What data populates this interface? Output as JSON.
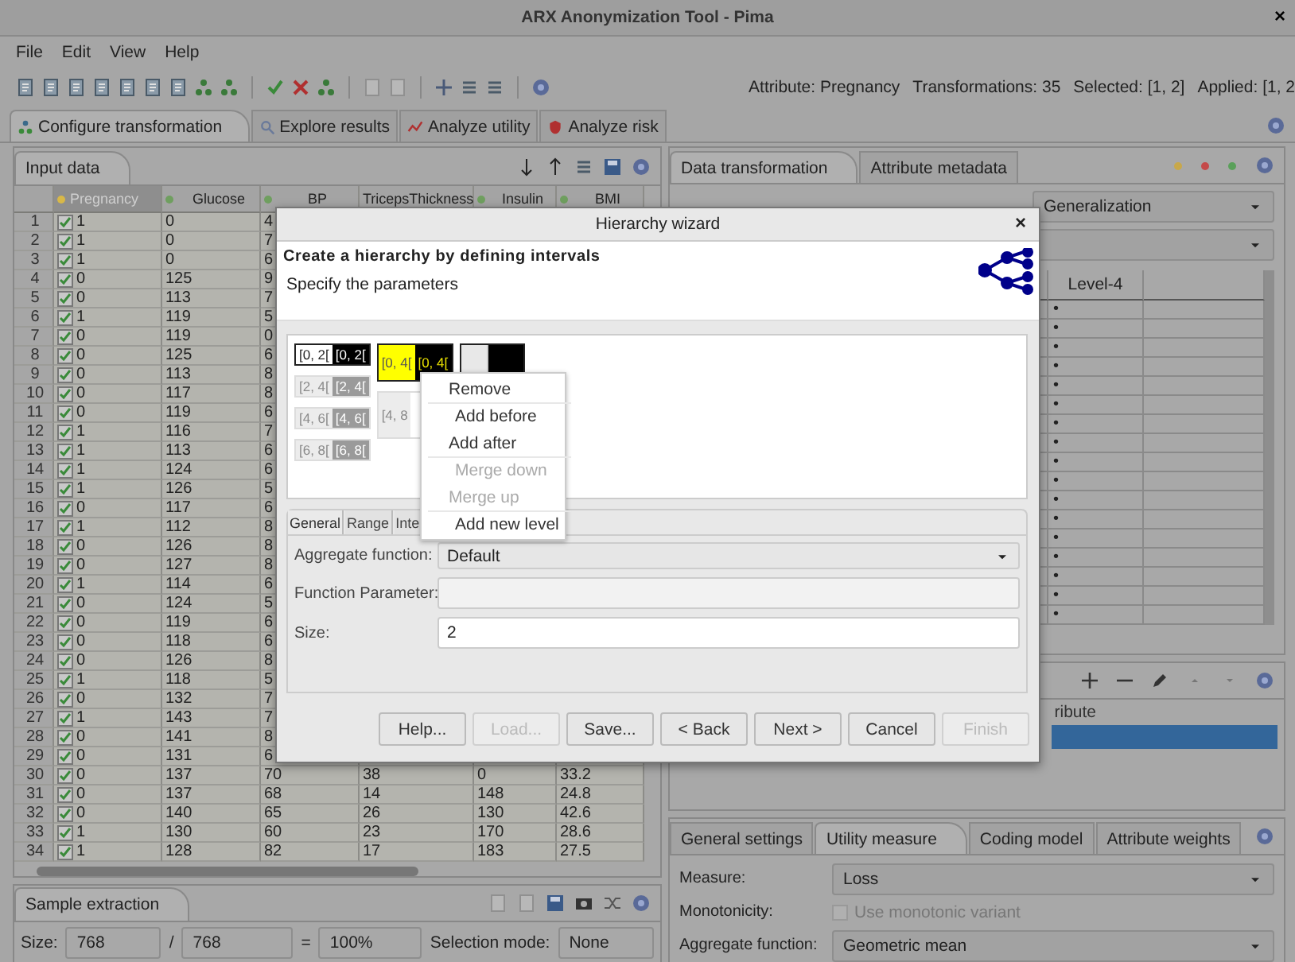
{
  "window": {
    "title": "ARX Anonymization Tool - Pima",
    "close": "×"
  },
  "menu": [
    "File",
    "Edit",
    "View",
    "Help"
  ],
  "status": [
    "Attribute: Pregnancy",
    "Transformations: 35",
    "Selected: [1, 2]",
    "Applied: [1, 2"
  ],
  "perspective_tabs": [
    {
      "label": "Configure transformation",
      "selected": true
    },
    {
      "label": "Explore results",
      "selected": false
    },
    {
      "label": "Analyze utility",
      "selected": false
    },
    {
      "label": "Analyze risk",
      "selected": false
    }
  ],
  "input_data": {
    "tab": "Input data",
    "columns": [
      {
        "label": "Pregnancy",
        "selected": true,
        "color": "#d8b848"
      },
      {
        "label": "Glucose",
        "selected": false,
        "color": "#6f9f5f"
      },
      {
        "label": "BP",
        "selected": false,
        "color": "#6f9f5f"
      },
      {
        "label": "TricepsThickness",
        "selected": false
      },
      {
        "label": "Insulin",
        "selected": false,
        "color": "#6f9f5f"
      },
      {
        "label": "BMI",
        "selected": false,
        "color": "#6f9f5f"
      }
    ],
    "rows": [
      {
        "n": "1",
        "included": true,
        "cells": [
          "1",
          "0",
          "4"
        ]
      },
      {
        "n": "2",
        "included": true,
        "cells": [
          "1",
          "0",
          "7"
        ]
      },
      {
        "n": "3",
        "included": true,
        "cells": [
          "1",
          "0",
          "6"
        ]
      },
      {
        "n": "4",
        "included": true,
        "cells": [
          "0",
          "125",
          "9"
        ]
      },
      {
        "n": "5",
        "included": true,
        "cells": [
          "0",
          "113",
          "7"
        ]
      },
      {
        "n": "6",
        "included": true,
        "cells": [
          "1",
          "119",
          "5"
        ]
      },
      {
        "n": "7",
        "included": true,
        "cells": [
          "0",
          "119",
          "0"
        ]
      },
      {
        "n": "8",
        "included": true,
        "cells": [
          "0",
          "125",
          "6"
        ]
      },
      {
        "n": "9",
        "included": true,
        "cells": [
          "0",
          "113",
          "8"
        ]
      },
      {
        "n": "10",
        "included": true,
        "cells": [
          "0",
          "117",
          "8"
        ]
      },
      {
        "n": "11",
        "included": true,
        "cells": [
          "0",
          "119",
          "6"
        ]
      },
      {
        "n": "12",
        "included": true,
        "cells": [
          "1",
          "116",
          "7"
        ]
      },
      {
        "n": "13",
        "included": true,
        "cells": [
          "1",
          "113",
          "6"
        ]
      },
      {
        "n": "14",
        "included": true,
        "cells": [
          "1",
          "124",
          "6"
        ]
      },
      {
        "n": "15",
        "included": true,
        "cells": [
          "1",
          "126",
          "5"
        ]
      },
      {
        "n": "16",
        "included": true,
        "cells": [
          "0",
          "117",
          "6"
        ]
      },
      {
        "n": "17",
        "included": true,
        "cells": [
          "1",
          "112",
          "8"
        ]
      },
      {
        "n": "18",
        "included": true,
        "cells": [
          "0",
          "126",
          "8"
        ]
      },
      {
        "n": "19",
        "included": true,
        "cells": [
          "0",
          "127",
          "8"
        ]
      },
      {
        "n": "20",
        "included": true,
        "cells": [
          "1",
          "114",
          "6"
        ]
      },
      {
        "n": "21",
        "included": true,
        "cells": [
          "0",
          "124",
          "5"
        ]
      },
      {
        "n": "22",
        "included": true,
        "cells": [
          "0",
          "119",
          "6"
        ]
      },
      {
        "n": "23",
        "included": true,
        "cells": [
          "0",
          "118",
          "6"
        ]
      },
      {
        "n": "24",
        "included": true,
        "cells": [
          "0",
          "126",
          "8"
        ]
      },
      {
        "n": "25",
        "included": true,
        "cells": [
          "1",
          "118",
          "5"
        ]
      },
      {
        "n": "26",
        "included": true,
        "cells": [
          "0",
          "132",
          "7"
        ]
      },
      {
        "n": "27",
        "included": true,
        "cells": [
          "1",
          "143",
          "7"
        ]
      },
      {
        "n": "28",
        "included": true,
        "cells": [
          "0",
          "141",
          "8"
        ]
      },
      {
        "n": "29",
        "included": true,
        "cells": [
          "0",
          "131",
          "6"
        ]
      },
      {
        "n": "30",
        "included": true,
        "cells": [
          "0",
          "137",
          "70",
          "38",
          "0",
          "33.2"
        ]
      },
      {
        "n": "31",
        "included": true,
        "cells": [
          "0",
          "137",
          "68",
          "14",
          "148",
          "24.8"
        ]
      },
      {
        "n": "32",
        "included": true,
        "cells": [
          "0",
          "140",
          "65",
          "26",
          "130",
          "42.6"
        ]
      },
      {
        "n": "33",
        "included": true,
        "cells": [
          "1",
          "130",
          "60",
          "23",
          "170",
          "28.6"
        ]
      },
      {
        "n": "34",
        "included": true,
        "cells": [
          "1",
          "128",
          "82",
          "17",
          "183",
          "27.5"
        ]
      }
    ]
  },
  "sample_extraction": {
    "tab": "Sample extraction",
    "size_label": "Size:",
    "size": "768",
    "slash": "/",
    "total": "768",
    "equals": "=",
    "percent": "100%",
    "mode_label": "Selection mode:",
    "mode": "None"
  },
  "data_transformation": {
    "tabs": [
      {
        "label": "Data transformation",
        "selected": true
      },
      {
        "label": "Attribute metadata",
        "selected": false
      }
    ],
    "indicators": [
      {
        "color": "#c8a84a"
      },
      {
        "color": "#c44a4a"
      },
      {
        "color": "#5aa05a"
      }
    ],
    "transformation": "Generalization",
    "table": {
      "columns": [
        "Level-4"
      ],
      "rows": [
        {
          "level_4": "•"
        },
        {
          "level_4": "•"
        },
        {
          "level_4": "•"
        },
        {
          "level_4": "•"
        },
        {
          "level_4": "•"
        },
        {
          "level_4": "•"
        },
        {
          "level_4": "•"
        },
        {
          "level_4": "•"
        },
        {
          "level_4": "•"
        },
        {
          "level_4": "•"
        },
        {
          "level_4": "•"
        },
        {
          "level_4": "•"
        },
        {
          "level_4": "•"
        },
        {
          "level_4": "•"
        },
        {
          "level_4": "•"
        },
        {
          "level_4": "•"
        },
        {
          "level_4": "•"
        }
      ]
    },
    "attribute_table": {
      "header": "ribute",
      "rows": [
        {
          "selected": true
        }
      ]
    }
  },
  "settings": {
    "tabs": [
      {
        "label": "General settings",
        "selected": false
      },
      {
        "label": "Utility measure",
        "selected": true
      },
      {
        "label": "Coding model",
        "selected": false
      },
      {
        "label": "Attribute weights",
        "selected": false
      }
    ],
    "measure_label": "Measure:",
    "measure": "Loss",
    "monotonicity_label": "Monotonicity:",
    "monotonic": {
      "label": "Use monotonic variant",
      "checked": false,
      "disabled": true
    },
    "aggregate_label": "Aggregate function:",
    "aggregate": "Geometric mean"
  },
  "dialog": {
    "title": "Hierarchy wizard",
    "close": "×",
    "heading": "Create a hierarchy by defining intervals",
    "subheading": "Specify the parameters",
    "levels": [
      {
        "items": [
          {
            "labels": [
              "[0, 2[",
              "[0, 2["
            ],
            "active": true,
            "selected": false
          },
          {
            "labels": [
              "[2, 4[",
              "[2, 4["
            ],
            "active": false,
            "selected": false
          },
          {
            "labels": [
              "[4, 6[",
              "[4, 6["
            ],
            "active": false,
            "selected": false
          },
          {
            "labels": [
              "[6, 8[",
              "[6, 8["
            ],
            "active": false,
            "selected": false
          }
        ]
      },
      {
        "items": [
          {
            "labels": [
              "[0, 4[",
              "[0, 4["
            ],
            "active": true,
            "selected": true
          },
          {
            "labels": [
              "[4, 8"
            ],
            "active": false,
            "selected": false
          }
        ]
      },
      {
        "items": [
          {
            "active": true,
            "selected": false,
            "kind": "empty"
          }
        ]
      }
    ],
    "tabs": [
      {
        "label": "General",
        "selected": true
      },
      {
        "label": "Range",
        "selected": false
      },
      {
        "label": "Inte",
        "selected": false
      }
    ],
    "aggregate_label": "Aggregate function:",
    "aggregate": "Default",
    "parameter_label": "Function Parameter:",
    "size_label": "Size:",
    "size": "2",
    "buttons": [
      {
        "label": "Help...",
        "disabled": false
      },
      {
        "label": "Load...",
        "disabled": true
      },
      {
        "label": "Save...",
        "disabled": false
      },
      {
        "label": "< Back",
        "disabled": false
      },
      {
        "label": "Next >",
        "disabled": false
      },
      {
        "label": "Cancel",
        "disabled": false
      },
      {
        "label": "Finish",
        "disabled": true
      }
    ]
  },
  "context_menu": [
    {
      "label": "Remove",
      "disabled": false,
      "separator_before": false
    },
    {
      "label": "Add before",
      "disabled": false,
      "separator_before": true
    },
    {
      "label": "Add after",
      "disabled": false,
      "separator_before": false
    },
    {
      "label": "Merge down",
      "disabled": true,
      "separator_before": true
    },
    {
      "label": "Merge up",
      "disabled": true,
      "separator_before": false
    },
    {
      "label": "Add new level",
      "disabled": false,
      "separator_before": true
    }
  ]
}
